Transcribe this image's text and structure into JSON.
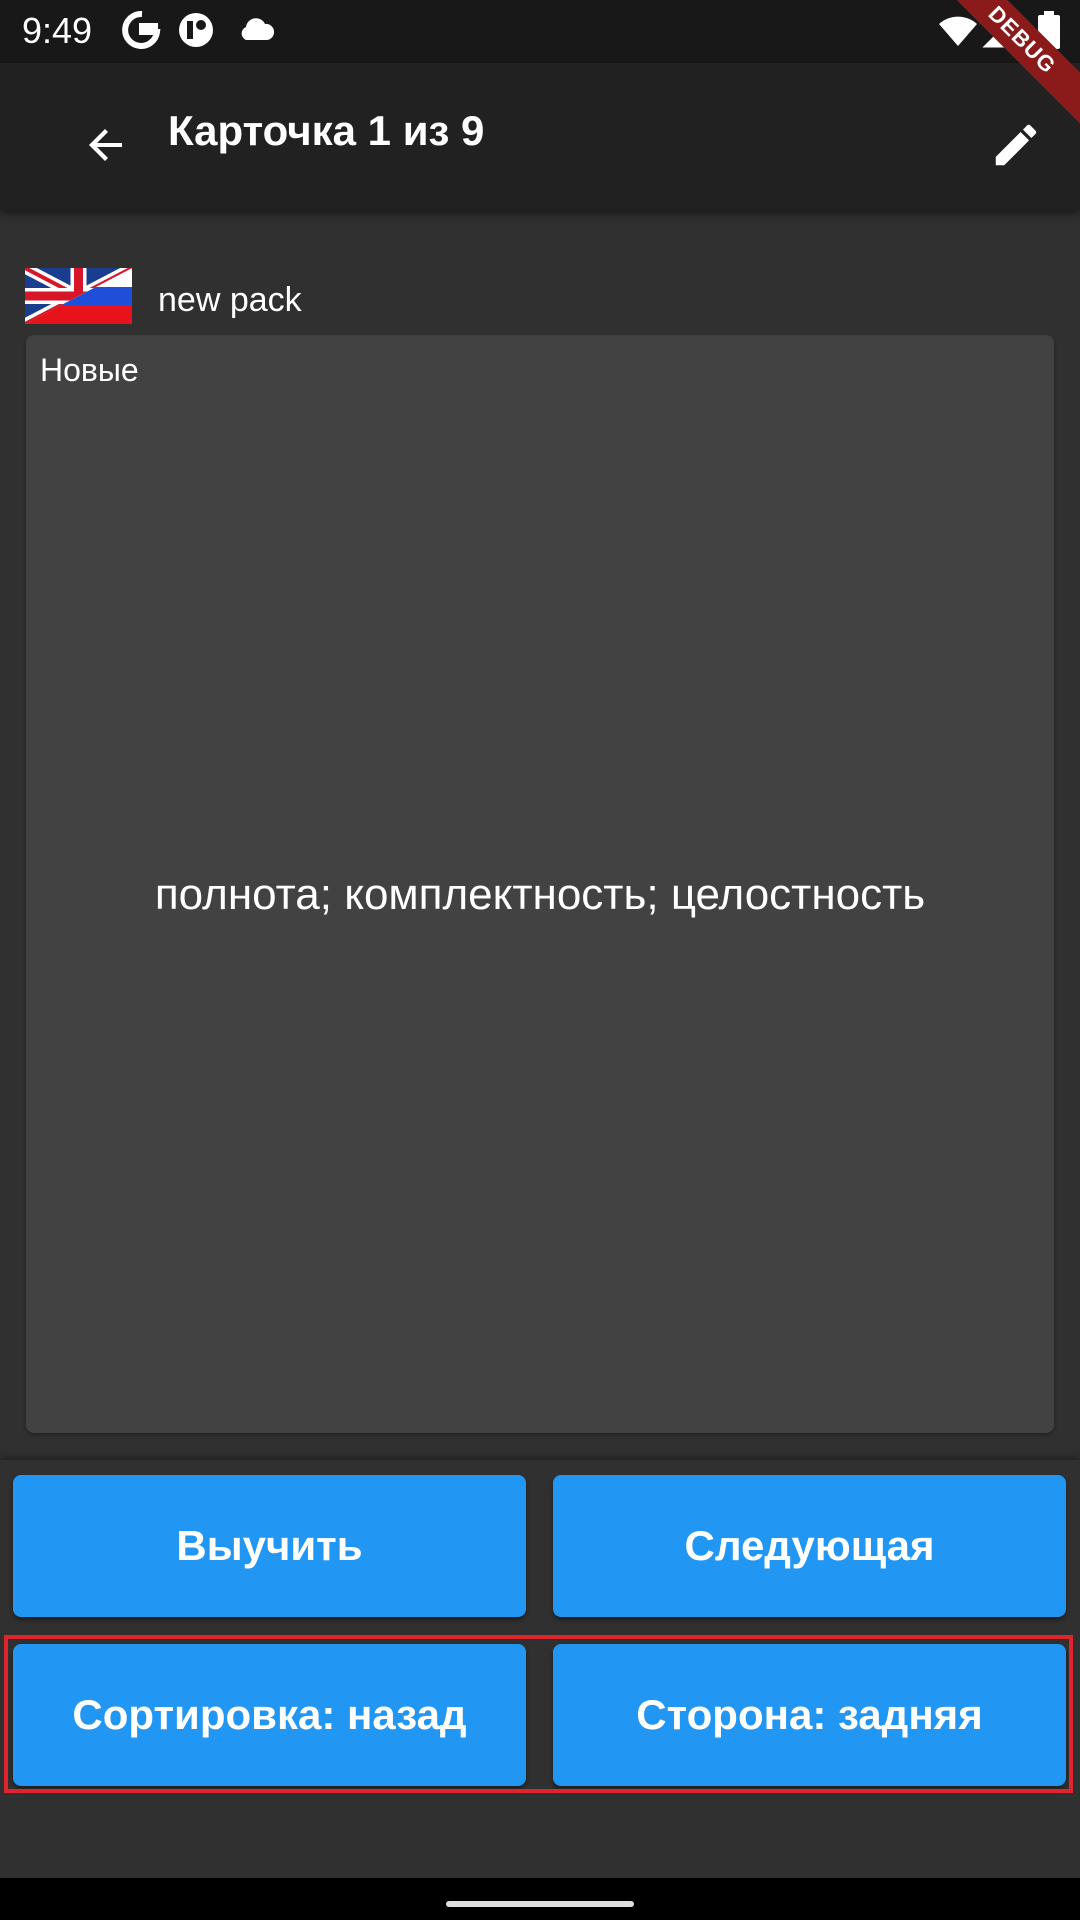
{
  "status_bar": {
    "time": "9:49",
    "left_icons": [
      "google-icon",
      "app-notification-icon",
      "cloud-icon"
    ],
    "right_icons": [
      "wifi-icon",
      "signal-icon",
      "battery-icon"
    ]
  },
  "debug_banner": {
    "label": "DEBUG"
  },
  "app_bar": {
    "title": "Карточка 1 из 9",
    "back_icon": "arrow-back-icon",
    "edit_icon": "edit-pencil-icon"
  },
  "pack": {
    "flag_icon": "uk-russia-flag-icon",
    "name": "new pack"
  },
  "card": {
    "status": "Новые",
    "text": "полнота; комплектность; целостность"
  },
  "actions": {
    "learn": "Выучить",
    "next": "Следующая",
    "sort": "Сортировка: назад",
    "side": "Сторона: задняя"
  },
  "colors": {
    "background": "#303030",
    "app_bar": "#212121",
    "status_bar": "#181818",
    "card": "#424242",
    "button": "#2196f3",
    "highlight": "#e0242c",
    "debug_banner": "#8b1a1a"
  }
}
